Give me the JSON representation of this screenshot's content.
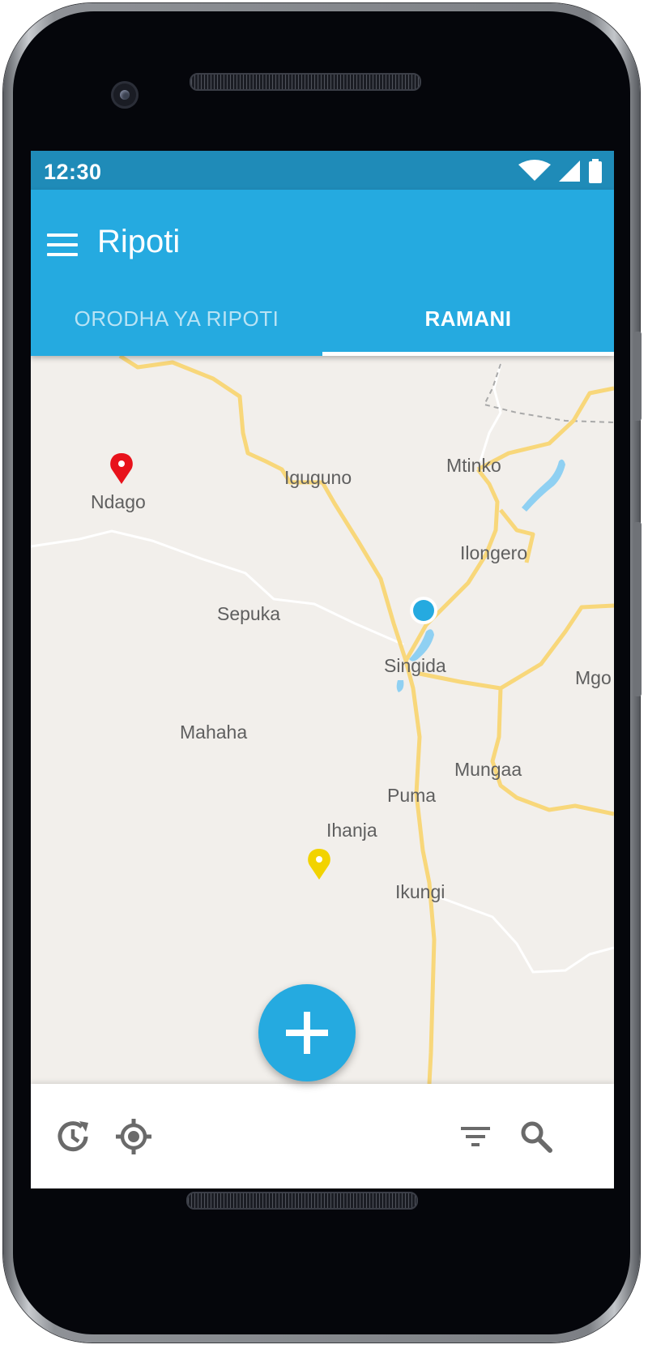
{
  "status": {
    "time": "12:30"
  },
  "app": {
    "title": "Ripoti"
  },
  "tabs": [
    {
      "label": "ORODHA YA RIPOTI",
      "active": false
    },
    {
      "label": "RAMANI",
      "active": true
    }
  ],
  "map": {
    "places": [
      "Ndago",
      "Iguguno",
      "Mtinko",
      "Ilongero",
      "Sepuka",
      "Singida",
      "Mgo",
      "Mahaha",
      "Mungaa",
      "Puma",
      "Ihanja",
      "Ikungi"
    ],
    "markers": [
      {
        "color": "#e8121b"
      },
      {
        "color": "#f2d300"
      }
    ],
    "current_location_color": "#25aae0"
  },
  "colors": {
    "primary": "#25aae0",
    "status_bar": "#1f8bb8",
    "map_background": "#f2efeb",
    "road": "#f8d77a",
    "water": "#8fd0f2"
  },
  "icons": {
    "menu": "menu-icon",
    "wifi": "wifi-icon",
    "signal": "signal-icon",
    "battery": "battery-icon",
    "history": "history-icon",
    "locate": "my-location-icon",
    "filter": "filter-icon",
    "search": "search-icon",
    "add": "add-icon"
  }
}
